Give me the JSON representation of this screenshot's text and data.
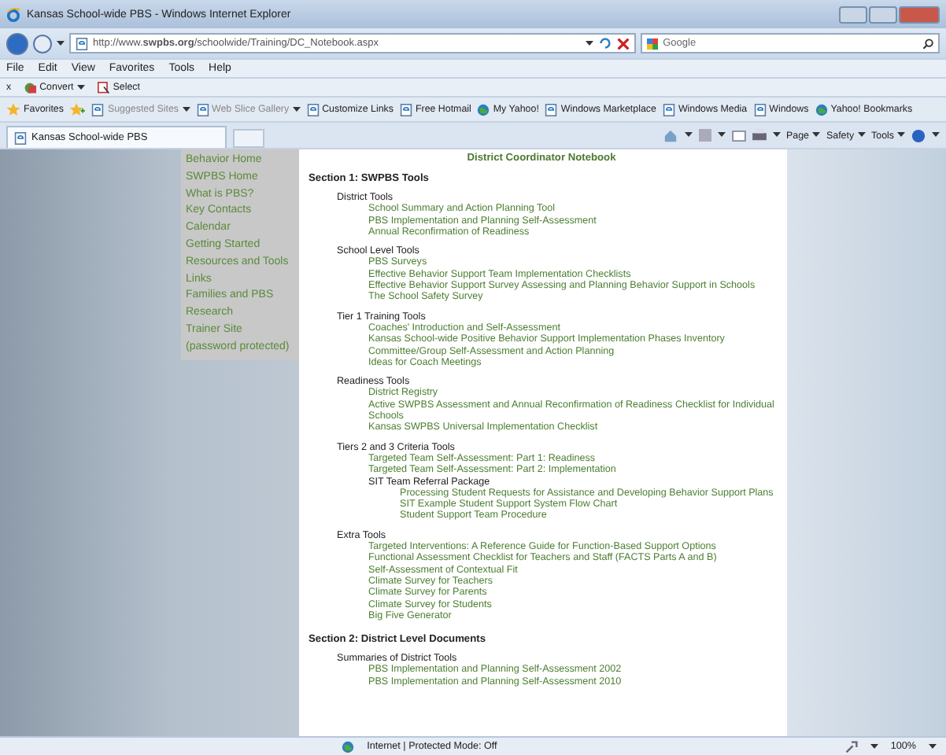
{
  "window": {
    "title": "Kansas School-wide PBS - Windows Internet Explorer"
  },
  "address_bar": {
    "url": "http://www.**swpbs.org**/schoolwide/Training/DC_Notebook.aspx"
  },
  "search": {
    "placeholder": "Google"
  },
  "menu": [
    "File",
    "Edit",
    "View",
    "Favorites",
    "Tools",
    "Help"
  ],
  "convert_bar": {
    "close": "x",
    "items": [
      {
        "label": "Convert",
        "dropdown": true
      },
      {
        "label": "Select",
        "dropdown": false
      }
    ]
  },
  "favorites_bar": {
    "label": "Favorites",
    "items": [
      {
        "label": "Suggested Sites",
        "dropdown": true,
        "dimmed": true
      },
      {
        "label": "Web Slice Gallery",
        "dropdown": true,
        "dimmed": true
      },
      {
        "label": "Customize Links",
        "dropdown": false,
        "dimmed": false
      },
      {
        "label": "Free Hotmail",
        "dropdown": false,
        "dimmed": false
      },
      {
        "label": "My Yahoo!",
        "dropdown": false,
        "dimmed": false
      },
      {
        "label": "Windows Marketplace",
        "dropdown": false,
        "dimmed": false
      },
      {
        "label": "Windows Media",
        "dropdown": false,
        "dimmed": false
      },
      {
        "label": "Windows",
        "dropdown": false,
        "dimmed": false
      },
      {
        "label": "Yahoo! Bookmarks",
        "dropdown": false,
        "dimmed": false
      }
    ]
  },
  "tabs": [
    {
      "label": "Kansas School-wide PBS",
      "selected": true
    }
  ],
  "command_bar": [
    "Page",
    "Safety",
    "Tools"
  ],
  "sidebar": {
    "items": [
      "Behavior Home",
      "SWPBS Home",
      "What is PBS?",
      "Key Contacts",
      "Calendar",
      "Getting Started",
      "Resources and Tools",
      "Links",
      "Families and PBS",
      "Research",
      "Trainer Site (password protected)"
    ]
  },
  "page": {
    "title": "District Coordinator Notebook",
    "sections": [
      {
        "title": "Section 1: SWPBS Tools",
        "groups": [
          {
            "title": "District Tools",
            "items": [
              {
                "text": "School Summary and Action Planning Tool"
              },
              {
                "text": "PBS Implementation and Planning Self-Assessment"
              },
              {
                "text": "Annual Reconfirmation of Readiness"
              }
            ]
          },
          {
            "title": "School Level Tools",
            "items": [
              {
                "text": "PBS Surveys"
              },
              {
                "text": "Effective Behavior Support Team Implementation Checklists"
              },
              {
                "text": "Effective Behavior Support Survey Assessing and Planning Behavior Support in Schools"
              },
              {
                "text": "The School Safety Survey"
              }
            ]
          },
          {
            "title": "Tier 1 Training Tools",
            "items": [
              {
                "text": "Coaches' Introduction and Self-Assessment"
              },
              {
                "text": "Kansas School-wide Positive Behavior Support Implementation Phases Inventory"
              },
              {
                "text": "Committee/Group Self-Assessment and Action Planning"
              },
              {
                "text": "Ideas for Coach Meetings"
              }
            ]
          },
          {
            "title": "Readiness Tools",
            "items": [
              {
                "text": "District Registry"
              },
              {
                "text": "Active SWPBS Assessment and Annual Reconfirmation of Readiness Checklist for Individual Schools"
              },
              {
                "text": "Kansas SWPBS Universal Implementation Checklist"
              }
            ]
          },
          {
            "title": "Tiers 2 and 3 Criteria Tools",
            "items": [
              {
                "text": "Targeted Team Self-Assessment: Part 1: Readiness"
              },
              {
                "text": "Targeted Team Self-Assessment: Part 2: Implementation"
              },
              {
                "text": "SIT Team Referral Package",
                "children": [
                  {
                    "text": "Processing Student Requests for Assistance and Developing Behavior Support Plans"
                  },
                  {
                    "text": "SIT Example Student Support System Flow Chart"
                  },
                  {
                    "text": "Student Support Team Procedure"
                  }
                ]
              }
            ]
          },
          {
            "title": "Extra Tools",
            "items": [
              {
                "text": "Targeted Interventions: A Reference Guide for Function-Based Support Options"
              },
              {
                "text": "Functional Assessment Checklist for Teachers and Staff (FACTS Parts A and B)"
              },
              {
                "text": "Self-Assessment of Contextual Fit"
              },
              {
                "text": "Climate Survey for Teachers"
              },
              {
                "text": "Climate Survey for Parents"
              },
              {
                "text": "Climate Survey for Students"
              },
              {
                "text": "Big Five Generator"
              }
            ]
          }
        ]
      },
      {
        "title": "Section 2: District Level Documents",
        "groups": [
          {
            "title": "Summaries of District Tools",
            "items": [
              {
                "text": "PBS Implementation and Planning Self-Assessment 2002"
              },
              {
                "text": "PBS Implementation and Planning Self-Assessment 2010"
              }
            ]
          }
        ]
      }
    ]
  },
  "status_bar": {
    "zone": "Internet | Protected Mode: Off",
    "zoom": "100%"
  }
}
